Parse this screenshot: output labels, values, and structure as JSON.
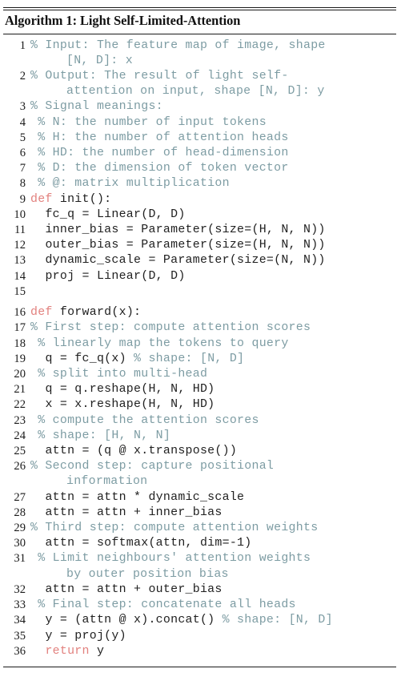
{
  "document": {
    "kind": "algorithm-float",
    "caption": "Algorithm 1: Light Self-Limited-Attention",
    "language": "pseudocode-python",
    "comment_marker": "%",
    "total_lines": 36
  },
  "colors": {
    "comment": "#7d9ca3",
    "keyword": "#e2817e",
    "code": "#1f1f1f",
    "rule": "#1a1a1a",
    "background": "#ffffff"
  },
  "lines": [
    {
      "n": "1",
      "main": "% Input: The feature map of image, shape",
      "main_kind": "cmt",
      "cont": "[N, D]: x",
      "cont_kind": "cmt"
    },
    {
      "n": "2",
      "main": "% Output: The result of light self-",
      "main_kind": "cmt",
      "cont": "attention on input, shape [N, D]: y",
      "cont_kind": "cmt"
    },
    {
      "n": "3",
      "main": "% Signal meanings:",
      "main_kind": "cmt"
    },
    {
      "n": "4",
      "main": " % N: the number of input tokens",
      "main_kind": "cmt"
    },
    {
      "n": "5",
      "main": " % H: the number of attention heads",
      "main_kind": "cmt"
    },
    {
      "n": "6",
      "main": " % HD: the number of head-dimension",
      "main_kind": "cmt"
    },
    {
      "n": "7",
      "main": " % D: the dimension of token vector",
      "main_kind": "cmt"
    },
    {
      "n": "8",
      "main": " % @: matrix multiplication",
      "main_kind": "cmt"
    },
    {
      "n": "9",
      "kw": "def",
      "main": " init():",
      "main_kind": "cd"
    },
    {
      "n": "10",
      "main": "  fc_q = Linear(D, D)",
      "main_kind": "cd"
    },
    {
      "n": "11",
      "main": "  inner_bias = Parameter(size=(H, N, N))",
      "main_kind": "cd"
    },
    {
      "n": "12",
      "main": "  outer_bias = Parameter(size=(H, N, N))",
      "main_kind": "cd"
    },
    {
      "n": "13",
      "main": "  dynamic_scale = Parameter(size=(N, N))",
      "main_kind": "cd"
    },
    {
      "n": "14",
      "main": "  proj = Linear(D, D)",
      "main_kind": "cd"
    },
    {
      "n": "15",
      "main": "",
      "main_kind": "cd"
    },
    {
      "n": "16",
      "kw": "def",
      "main": " forward(x):",
      "main_kind": "cd"
    },
    {
      "n": "17",
      "main": "% First step: compute attention scores",
      "main_kind": "cmt"
    },
    {
      "n": "18",
      "main": " % linearly map the tokens to query",
      "main_kind": "cmt"
    },
    {
      "n": "19",
      "main": "  q = fc_q(x) ",
      "main_kind": "cd",
      "tail": "% shape: [N, D]",
      "tail_kind": "cmt"
    },
    {
      "n": "20",
      "main": " % split into multi-head",
      "main_kind": "cmt"
    },
    {
      "n": "21",
      "main": "  q = q.reshape(H, N, HD)",
      "main_kind": "cd"
    },
    {
      "n": "22",
      "main": "  x = x.reshape(H, N, HD)",
      "main_kind": "cd"
    },
    {
      "n": "23",
      "main": " % compute the attention scores",
      "main_kind": "cmt"
    },
    {
      "n": "24",
      "main": " % shape: [H, N, N]",
      "main_kind": "cmt"
    },
    {
      "n": "25",
      "main": "  attn = (q @ x.transpose())",
      "main_kind": "cd"
    },
    {
      "n": "26",
      "main": "% Second step: capture positional",
      "main_kind": "cmt",
      "cont": "information",
      "cont_kind": "cmt"
    },
    {
      "n": "27",
      "main": "  attn = attn * dynamic_scale",
      "main_kind": "cd"
    },
    {
      "n": "28",
      "main": "  attn = attn + inner_bias",
      "main_kind": "cd"
    },
    {
      "n": "29",
      "main": "% Third step: compute attention weights",
      "main_kind": "cmt"
    },
    {
      "n": "30",
      "main": "  attn = softmax(attn, dim=-1)",
      "main_kind": "cd"
    },
    {
      "n": "31",
      "main": " % Limit neighbours' attention weights",
      "main_kind": "cmt",
      "cont": "by outer position bias",
      "cont_kind": "cmt"
    },
    {
      "n": "32",
      "main": "  attn = attn + outer_bias",
      "main_kind": "cd"
    },
    {
      "n": "33",
      "main": " % Final step: concatenate all heads",
      "main_kind": "cmt"
    },
    {
      "n": "34",
      "main": "  y = (attn @ x).concat() ",
      "main_kind": "cd",
      "tail": "% shape: [N, D]",
      "tail_kind": "cmt"
    },
    {
      "n": "35",
      "main": "  y = proj(y)",
      "main_kind": "cd"
    },
    {
      "n": "36",
      "kw": "  return",
      "main": " y",
      "main_kind": "cd"
    }
  ]
}
